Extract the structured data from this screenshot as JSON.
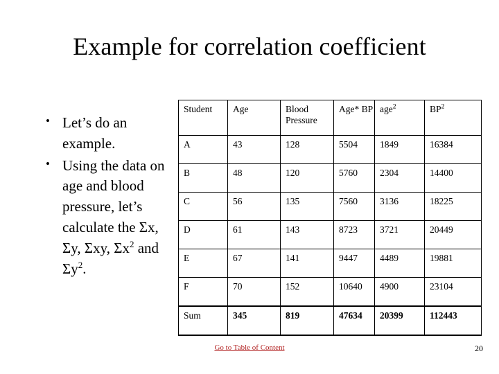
{
  "slide": {
    "title": "Example for correlation coefficient",
    "page_number": "20"
  },
  "bullets": [
    {
      "marker": "•",
      "text": "Let’s do an example."
    },
    {
      "marker": "•",
      "text": "Using the data on age and blood pressure, let’s calculate the Σx, Σy, Σxy, Σx² and Σy²."
    }
  ],
  "table": {
    "headers": {
      "student": "Student",
      "age": "Age",
      "blood_pressure": "Blood Pressure",
      "age_bp": "Age* BP",
      "age_squared_base": "age",
      "age_squared_exp": "2",
      "bp_squared_base": "BP",
      "bp_squared_exp": "2"
    },
    "rows": [
      {
        "student": "A",
        "age": "43",
        "blood_pressure": "128",
        "age_bp": "5504",
        "age_squared": "1849",
        "bp_squared": "16384"
      },
      {
        "student": "B",
        "age": "48",
        "blood_pressure": "120",
        "age_bp": "5760",
        "age_squared": "2304",
        "bp_squared": "14400"
      },
      {
        "student": "C",
        "age": "56",
        "blood_pressure": "135",
        "age_bp": "7560",
        "age_squared": "3136",
        "bp_squared": "18225"
      },
      {
        "student": "D",
        "age": "61",
        "blood_pressure": "143",
        "age_bp": "8723",
        "age_squared": "3721",
        "bp_squared": "20449"
      },
      {
        "student": "E",
        "age": "67",
        "blood_pressure": "141",
        "age_bp": "9447",
        "age_squared": "4489",
        "bp_squared": "19881"
      },
      {
        "student": "F",
        "age": "70",
        "blood_pressure": "152",
        "age_bp": "10640",
        "age_squared": "4900",
        "bp_squared": "23104"
      }
    ],
    "sum": {
      "label": "Sum",
      "age": "345",
      "blood_pressure": "819",
      "age_bp": "47634",
      "age_squared": "20399",
      "bp_squared": "112443"
    }
  },
  "footer": {
    "toc_label": "Go to Table of Content",
    "link_color": "#b22222"
  }
}
